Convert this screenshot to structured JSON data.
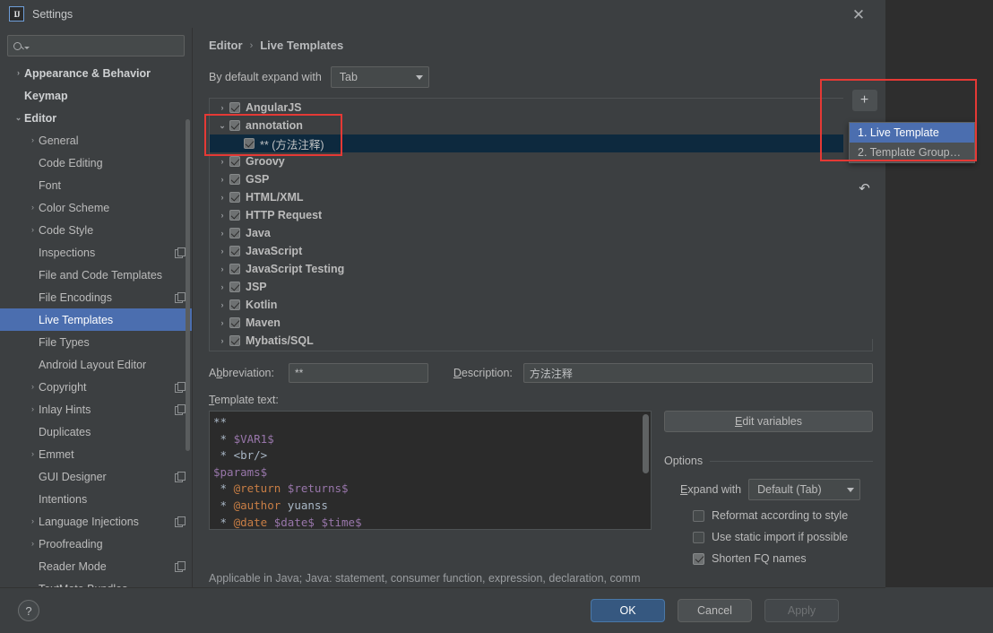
{
  "window": {
    "title": "Settings",
    "logo_text": "IJ",
    "close_icon": "close-icon"
  },
  "search": {
    "value": "",
    "placeholder": ""
  },
  "sidebar": {
    "items": [
      {
        "label": "Appearance & Behavior",
        "arrow": "›",
        "level": 0,
        "bold": true,
        "selected": false,
        "copy": false
      },
      {
        "label": "Keymap",
        "arrow": "",
        "level": 0,
        "bold": true,
        "selected": false,
        "copy": false
      },
      {
        "label": "Editor",
        "arrow": "⌄",
        "level": 0,
        "bold": true,
        "selected": false,
        "copy": false
      },
      {
        "label": "General",
        "arrow": "›",
        "level": 1,
        "bold": false,
        "selected": false,
        "copy": false
      },
      {
        "label": "Code Editing",
        "arrow": "",
        "level": 1,
        "bold": false,
        "selected": false,
        "copy": false
      },
      {
        "label": "Font",
        "arrow": "",
        "level": 1,
        "bold": false,
        "selected": false,
        "copy": false
      },
      {
        "label": "Color Scheme",
        "arrow": "›",
        "level": 1,
        "bold": false,
        "selected": false,
        "copy": false
      },
      {
        "label": "Code Style",
        "arrow": "›",
        "level": 1,
        "bold": false,
        "selected": false,
        "copy": false
      },
      {
        "label": "Inspections",
        "arrow": "",
        "level": 1,
        "bold": false,
        "selected": false,
        "copy": true
      },
      {
        "label": "File and Code Templates",
        "arrow": "",
        "level": 1,
        "bold": false,
        "selected": false,
        "copy": false
      },
      {
        "label": "File Encodings",
        "arrow": "",
        "level": 1,
        "bold": false,
        "selected": false,
        "copy": true
      },
      {
        "label": "Live Templates",
        "arrow": "",
        "level": 1,
        "bold": false,
        "selected": true,
        "copy": false
      },
      {
        "label": "File Types",
        "arrow": "",
        "level": 1,
        "bold": false,
        "selected": false,
        "copy": false
      },
      {
        "label": "Android Layout Editor",
        "arrow": "",
        "level": 1,
        "bold": false,
        "selected": false,
        "copy": false
      },
      {
        "label": "Copyright",
        "arrow": "›",
        "level": 1,
        "bold": false,
        "selected": false,
        "copy": true
      },
      {
        "label": "Inlay Hints",
        "arrow": "›",
        "level": 1,
        "bold": false,
        "selected": false,
        "copy": true
      },
      {
        "label": "Duplicates",
        "arrow": "",
        "level": 1,
        "bold": false,
        "selected": false,
        "copy": false
      },
      {
        "label": "Emmet",
        "arrow": "›",
        "level": 1,
        "bold": false,
        "selected": false,
        "copy": false
      },
      {
        "label": "GUI Designer",
        "arrow": "",
        "level": 1,
        "bold": false,
        "selected": false,
        "copy": true
      },
      {
        "label": "Intentions",
        "arrow": "",
        "level": 1,
        "bold": false,
        "selected": false,
        "copy": false
      },
      {
        "label": "Language Injections",
        "arrow": "›",
        "level": 1,
        "bold": false,
        "selected": false,
        "copy": true
      },
      {
        "label": "Proofreading",
        "arrow": "›",
        "level": 1,
        "bold": false,
        "selected": false,
        "copy": false
      },
      {
        "label": "Reader Mode",
        "arrow": "",
        "level": 1,
        "bold": false,
        "selected": false,
        "copy": true
      },
      {
        "label": "TextMate Bundles",
        "arrow": "",
        "level": 1,
        "bold": false,
        "selected": false,
        "copy": false
      }
    ]
  },
  "breadcrumb": {
    "parent": "Editor",
    "separator": "›",
    "current": "Live Templates"
  },
  "expand_default": {
    "label": "By default expand with",
    "value": "Tab"
  },
  "templates": [
    {
      "label": "AngularJS",
      "arrow": "›",
      "checked": true,
      "child": false,
      "selected": false
    },
    {
      "label": "annotation",
      "arrow": "⌄",
      "checked": true,
      "child": false,
      "selected": false
    },
    {
      "label": "** (方法注释)",
      "arrow": "",
      "checked": true,
      "child": true,
      "selected": true
    },
    {
      "label": "Groovy",
      "arrow": "›",
      "checked": true,
      "child": false,
      "selected": false
    },
    {
      "label": "GSP",
      "arrow": "›",
      "checked": true,
      "child": false,
      "selected": false
    },
    {
      "label": "HTML/XML",
      "arrow": "›",
      "checked": true,
      "child": false,
      "selected": false
    },
    {
      "label": "HTTP Request",
      "arrow": "›",
      "checked": true,
      "child": false,
      "selected": false
    },
    {
      "label": "Java",
      "arrow": "›",
      "checked": true,
      "child": false,
      "selected": false
    },
    {
      "label": "JavaScript",
      "arrow": "›",
      "checked": true,
      "child": false,
      "selected": false
    },
    {
      "label": "JavaScript Testing",
      "arrow": "›",
      "checked": true,
      "child": false,
      "selected": false
    },
    {
      "label": "JSP",
      "arrow": "›",
      "checked": true,
      "child": false,
      "selected": false
    },
    {
      "label": "Kotlin",
      "arrow": "›",
      "checked": true,
      "child": false,
      "selected": false
    },
    {
      "label": "Maven",
      "arrow": "›",
      "checked": true,
      "child": false,
      "selected": false
    },
    {
      "label": "Mybatis/SQL",
      "arrow": "›",
      "checked": true,
      "child": false,
      "selected": false
    }
  ],
  "toolbar": {
    "add_icon": "plus-icon",
    "remove_icon": "minus-icon",
    "revert_icon": "undo-icon"
  },
  "popup_menu": {
    "items": [
      {
        "label": "1. Live Template",
        "highlighted": true
      },
      {
        "label": "2. Template Group…",
        "highlighted": false
      }
    ]
  },
  "fields": {
    "abbreviation_label": "Abbreviation:",
    "abbreviation_value": "**",
    "description_label": "Description:",
    "description_value": "方法注释",
    "template_text_label": "Template text:"
  },
  "template_code_lines": [
    [
      {
        "t": "**",
        "c": "c-plain"
      }
    ],
    [
      {
        "t": " * ",
        "c": "c-plain"
      },
      {
        "t": "$VAR1$",
        "c": "c-var"
      }
    ],
    [
      {
        "t": " * ",
        "c": "c-plain"
      },
      {
        "t": "<br/>",
        "c": "c-tag"
      }
    ],
    [
      {
        "t": "$params$",
        "c": "c-var"
      }
    ],
    [
      {
        "t": " * ",
        "c": "c-plain"
      },
      {
        "t": "@return",
        "c": "c-doc"
      },
      {
        "t": " ",
        "c": "c-plain"
      },
      {
        "t": "$returns$",
        "c": "c-var"
      }
    ],
    [
      {
        "t": " * ",
        "c": "c-plain"
      },
      {
        "t": "@author",
        "c": "c-doc"
      },
      {
        "t": " yuanss",
        "c": "c-plain"
      }
    ],
    [
      {
        "t": " * ",
        "c": "c-plain"
      },
      {
        "t": "@date",
        "c": "c-doc"
      },
      {
        "t": " ",
        "c": "c-plain"
      },
      {
        "t": "$date$",
        "c": "c-var"
      },
      {
        "t": " ",
        "c": "c-plain"
      },
      {
        "t": "$time$",
        "c": "c-var"
      }
    ]
  ],
  "options": {
    "edit_variables_label": "Edit variables",
    "group_label": "Options",
    "expand_with_label": "Expand with",
    "expand_with_value": "Default (Tab)",
    "checkboxes": [
      {
        "label": "Reformat according to style",
        "checked": false
      },
      {
        "label": "Use static import if possible",
        "checked": false
      },
      {
        "label": "Shorten FQ names",
        "checked": true
      }
    ]
  },
  "applicable_text": "Applicable in Java; Java: statement, consumer function, expression, declaration, comm",
  "footer": {
    "help_label": "?",
    "ok_label": "OK",
    "cancel_label": "Cancel",
    "apply_label": "Apply"
  },
  "colors": {
    "dialog_bg": "#3c3f41",
    "selection_blue": "#4b6eaf",
    "row_selection": "#0d293e",
    "primary_button": "#365880",
    "annotation_red": "#e53935",
    "editor_bg": "#2b2b2b",
    "variable_purple": "#9876aa",
    "javadoc_orange": "#c87e45"
  }
}
